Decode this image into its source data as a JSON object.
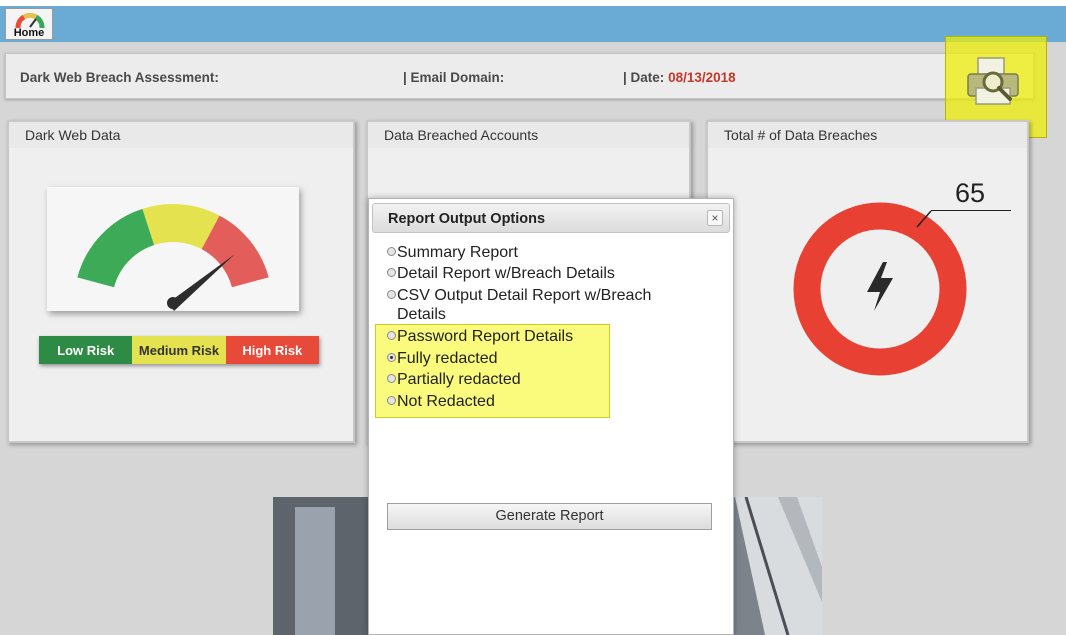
{
  "home": {
    "label": "Home"
  },
  "infobar": {
    "assessment_label": "Dark Web Breach Assessment:",
    "email_domain_label": "| Email Domain:",
    "date_label": "| Date:",
    "date_value": "08/13/2018"
  },
  "panels": {
    "dark_web_data": {
      "title": "Dark Web Data",
      "risk_levels": [
        "Low Risk",
        "Medium Risk",
        "High Risk"
      ],
      "colors": {
        "low": "#2e8b46",
        "medium": "#e5e24f",
        "high": "#e84a3a"
      }
    },
    "breached_accounts": {
      "title": "Data Breached Accounts"
    },
    "total_breaches": {
      "title": "Total # of Data Breaches",
      "count": "65",
      "ring_color": "#e84032"
    }
  },
  "dialog": {
    "title": "Report Output Options",
    "close_symbol": "×",
    "options": [
      {
        "label": "Summary Report",
        "selected": false
      },
      {
        "label": "Detail Report w/Breach Details",
        "selected": false
      },
      {
        "label": "CSV Output Detail Report w/Breach Details",
        "selected": false
      },
      {
        "label": "Password Report Details",
        "selected": false
      },
      {
        "label": "Fully redacted",
        "selected": true
      },
      {
        "label": "Partially redacted",
        "selected": false
      },
      {
        "label": "Not Redacted",
        "selected": false
      }
    ],
    "generate_button": "Generate Report"
  },
  "icons": {
    "home": "speedometer-icon",
    "print": "printer-search-icon",
    "breach": "lightning-icon",
    "close": "close-icon"
  }
}
